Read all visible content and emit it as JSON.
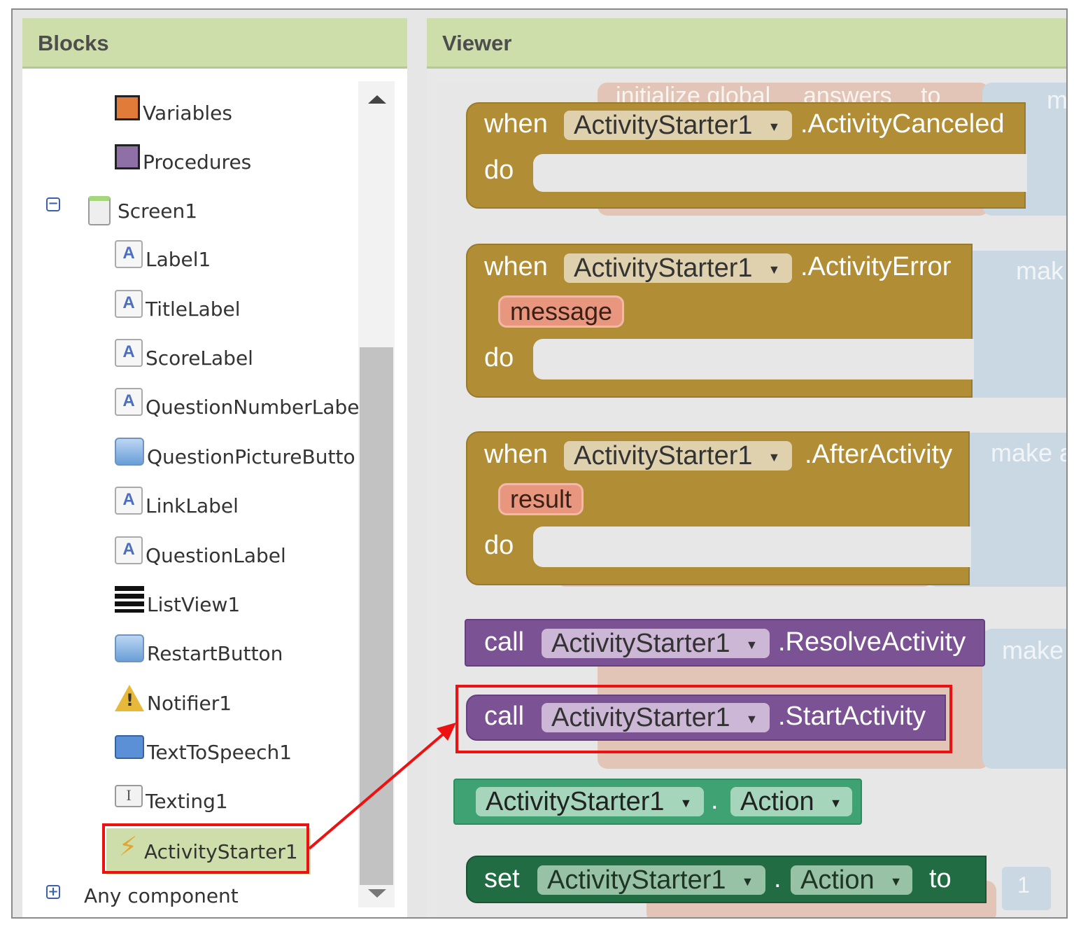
{
  "blocks_panel": {
    "title": "Blocks",
    "items": [
      {
        "label": "Variables",
        "icon": "variables-icon"
      },
      {
        "label": "Procedures",
        "icon": "procedures-icon"
      },
      {
        "label": "Screen1",
        "icon": "screen-icon"
      },
      {
        "label": "Label1",
        "icon": "label-icon"
      },
      {
        "label": "TitleLabel",
        "icon": "label-icon"
      },
      {
        "label": "ScoreLabel",
        "icon": "label-icon"
      },
      {
        "label": "QuestionNumberLabe",
        "icon": "label-icon"
      },
      {
        "label": "QuestionPictureButto",
        "icon": "button-icon"
      },
      {
        "label": "LinkLabel",
        "icon": "label-icon"
      },
      {
        "label": "QuestionLabel",
        "icon": "label-icon"
      },
      {
        "label": "ListView1",
        "icon": "listview-icon"
      },
      {
        "label": "RestartButton",
        "icon": "button-icon"
      },
      {
        "label": "Notifier1",
        "icon": "warning-icon"
      },
      {
        "label": "TextToSpeech1",
        "icon": "speech-bubble-icon"
      },
      {
        "label": "Texting1",
        "icon": "texting-icon"
      },
      {
        "label": "ActivityStarter1",
        "icon": "lightning-icon"
      },
      {
        "label": "Any component",
        "icon": "expand-icon"
      }
    ],
    "icons": {
      "label_glyph": "A",
      "texting_glyph": "I",
      "lightning_glyph": "⚡",
      "collapse_glyph": "−",
      "expand_glyph": "+"
    }
  },
  "viewer_panel": {
    "title": "Viewer",
    "background_blocks": {
      "init_text": "initialize global",
      "init_name": "answers",
      "init_to": "to",
      "make_1": "m",
      "make_2": "mak",
      "make_3": "make a",
      "make_4": "make",
      "number": "1"
    },
    "blocks": {
      "canceled": {
        "when": "when",
        "component": "ActivityStarter1",
        "event": ".ActivityCanceled",
        "do": "do"
      },
      "error": {
        "when": "when",
        "component": "ActivityStarter1",
        "event": ".ActivityError",
        "param": "message",
        "do": "do"
      },
      "after": {
        "when": "when",
        "component": "ActivityStarter1",
        "event": ".AfterActivity",
        "param": "result",
        "do": "do"
      },
      "resolve": {
        "call": "call",
        "component": "ActivityStarter1",
        "method": ".ResolveActivity"
      },
      "start": {
        "call": "call",
        "component": "ActivityStarter1",
        "method": ".StartActivity"
      },
      "getter": {
        "component": "ActivityStarter1",
        "dot": ".",
        "property": "Action"
      },
      "setter": {
        "set": "set",
        "component": "ActivityStarter1",
        "dot": ".",
        "property": "Action",
        "to": "to"
      }
    },
    "dropdown_arrow": "▼"
  },
  "colors": {
    "panel_header": "#cddeaa",
    "event_block": "#b18d36",
    "procedure_block": "#7b5293",
    "property_getter": "#3fa272",
    "property_setter": "#226c43",
    "highlight": "#ee1111"
  }
}
